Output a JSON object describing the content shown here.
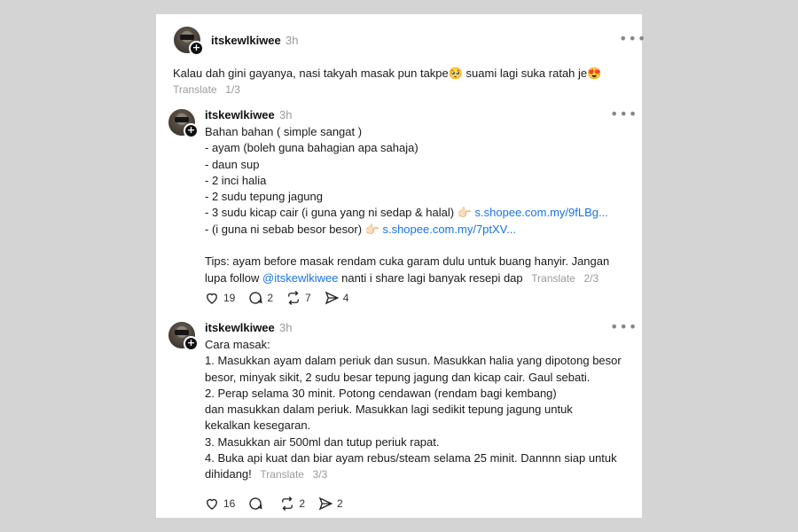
{
  "posts": [
    {
      "username": "itskewlkiwee",
      "time": "3h",
      "text": "Kalau dah gini gayanya, nasi takyah masak pun takpe🥺  suami lagi suka ratah je😍",
      "translate_label": "Translate",
      "page": "1/3"
    },
    {
      "username": "itskewlkiwee",
      "time": "3h",
      "lines": [
        "Bahan bahan ( simple sangat )",
        "- ayam (boleh guna bahagian apa sahaja)",
        "- daun sup",
        "- 2 inci halia",
        "- 2 sudu tepung jagung"
      ],
      "line_kicap": "- 3 sudu kicap cair (i guna yang ni sedap & halal) 👉🏻 ",
      "link_kicap": "s.shopee.com.my/9fLBg...",
      "line_besor": "- (i guna ni sebab besor besor) 👉🏻 ",
      "link_besor": "s.shopee.com.my/7ptXV...",
      "tips_1": "Tips: ayam before masak rendam cuka garam dulu untuk buang hanyir. Jangan",
      "tips_2_pre": "lupa follow ",
      "mention": "@itskewlkiwee",
      "tips_2_post": " nanti i share lagi banyak resepi dap",
      "translate_label": "Translate",
      "page": "2/3",
      "likes": "19",
      "replies": "2",
      "reposts": "7",
      "shares": "4"
    },
    {
      "username": "itskewlkiwee",
      "time": "3h",
      "lines": [
        "Cara masak:",
        "1. Masukkan ayam dalam periuk dan susun. Masukkan halia yang dipotong besor",
        "besor, minyak sikit, 2 sudu besar tepung jagung dan kicap cair. Gaul sebati.",
        "2. Perap selama 30 minit. Potong cendawan (rendam bagi kembang)",
        "dan masukkan dalam periuk. Masukkan lagi sedikit tepung jagung untuk",
        "kekalkan kesegaran.",
        "3. Masukkan air 500ml dan tutup periuk rapat.",
        "4. Buka api kuat dan biar ayam rebus/steam selama 25 minit. Dannnn siap untuk"
      ],
      "last_line": "dihidang!",
      "translate_label": "Translate",
      "page": "3/3",
      "likes": "16",
      "reposts": "2",
      "shares": "2"
    }
  ],
  "icons": {
    "like": "heart-icon",
    "reply": "comment-icon",
    "repost": "repost-icon",
    "share": "send-icon",
    "more": "more-icon"
  }
}
